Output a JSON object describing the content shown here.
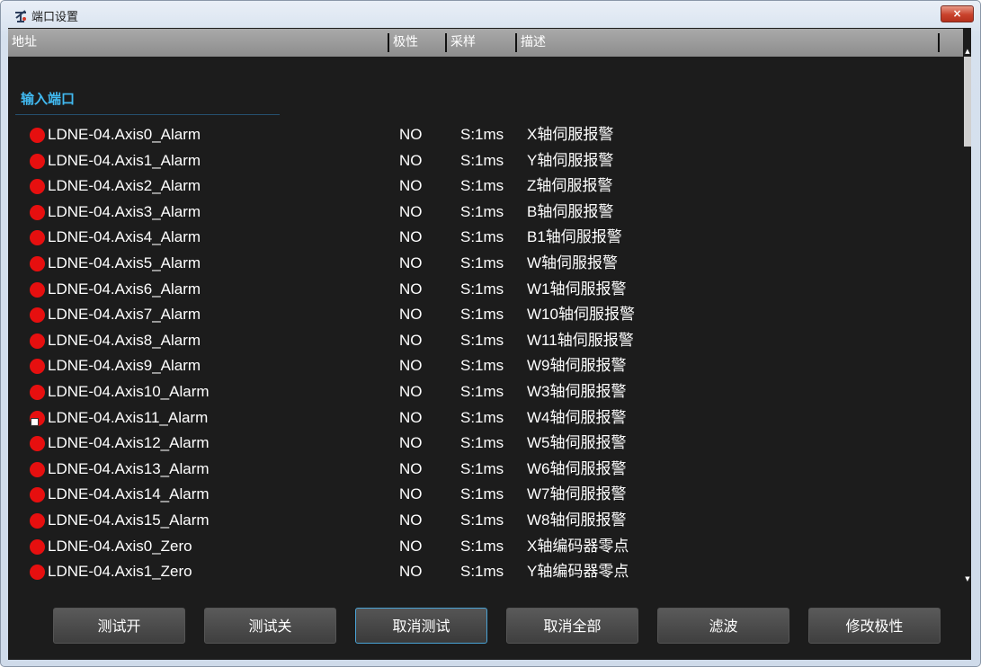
{
  "window": {
    "title": "端口设置",
    "close_label": "×"
  },
  "columns": {
    "address": "地址",
    "polarity": "极性",
    "sampling": "采样",
    "description": "描述"
  },
  "section": {
    "label": "输入端口"
  },
  "rows": [
    {
      "address": "LDNE-04.Axis0_Alarm",
      "polarity": "NO",
      "sampling": "S:1ms",
      "description": "X轴伺服报警",
      "status": "red"
    },
    {
      "address": "LDNE-04.Axis1_Alarm",
      "polarity": "NO",
      "sampling": "S:1ms",
      "description": "Y轴伺服报警",
      "status": "red"
    },
    {
      "address": "LDNE-04.Axis2_Alarm",
      "polarity": "NO",
      "sampling": "S:1ms",
      "description": "Z轴伺服报警",
      "status": "red"
    },
    {
      "address": "LDNE-04.Axis3_Alarm",
      "polarity": "NO",
      "sampling": "S:1ms",
      "description": "B轴伺服报警",
      "status": "red"
    },
    {
      "address": "LDNE-04.Axis4_Alarm",
      "polarity": "NO",
      "sampling": "S:1ms",
      "description": "B1轴伺服报警",
      "status": "red"
    },
    {
      "address": "LDNE-04.Axis5_Alarm",
      "polarity": "NO",
      "sampling": "S:1ms",
      "description": "W轴伺服报警",
      "status": "red"
    },
    {
      "address": "LDNE-04.Axis6_Alarm",
      "polarity": "NO",
      "sampling": "S:1ms",
      "description": "W1轴伺服报警",
      "status": "red"
    },
    {
      "address": "LDNE-04.Axis7_Alarm",
      "polarity": "NO",
      "sampling": "S:1ms",
      "description": "W10轴伺服报警",
      "status": "red"
    },
    {
      "address": "LDNE-04.Axis8_Alarm",
      "polarity": "NO",
      "sampling": "S:1ms",
      "description": "W11轴伺服报警",
      "status": "red"
    },
    {
      "address": "LDNE-04.Axis9_Alarm",
      "polarity": "NO",
      "sampling": "S:1ms",
      "description": "W9轴伺服报警",
      "status": "red"
    },
    {
      "address": "LDNE-04.Axis10_Alarm",
      "polarity": "NO",
      "sampling": "S:1ms",
      "description": "W3轴伺服报警",
      "status": "red"
    },
    {
      "address": "LDNE-04.Axis11_Alarm",
      "polarity": "NO",
      "sampling": "S:1ms",
      "description": "W4轴伺服报警",
      "status": "red-test"
    },
    {
      "address": "LDNE-04.Axis12_Alarm",
      "polarity": "NO",
      "sampling": "S:1ms",
      "description": "W5轴伺服报警",
      "status": "red"
    },
    {
      "address": "LDNE-04.Axis13_Alarm",
      "polarity": "NO",
      "sampling": "S:1ms",
      "description": "W6轴伺服报警",
      "status": "red"
    },
    {
      "address": "LDNE-04.Axis14_Alarm",
      "polarity": "NO",
      "sampling": "S:1ms",
      "description": "W7轴伺服报警",
      "status": "red"
    },
    {
      "address": "LDNE-04.Axis15_Alarm",
      "polarity": "NO",
      "sampling": "S:1ms",
      "description": "W8轴伺服报警",
      "status": "red"
    },
    {
      "address": "LDNE-04.Axis0_Zero",
      "polarity": "NO",
      "sampling": "S:1ms",
      "description": "X轴编码器零点",
      "status": "red"
    },
    {
      "address": "LDNE-04.Axis1_Zero",
      "polarity": "NO",
      "sampling": "S:1ms",
      "description": "Y轴编码器零点",
      "status": "red"
    },
    {
      "address": "",
      "polarity": "",
      "sampling": "",
      "description": "",
      "status": "green"
    }
  ],
  "buttons": [
    {
      "label": "测试开",
      "name": "test-on-button"
    },
    {
      "label": "测试关",
      "name": "test-off-button"
    },
    {
      "label": "取消测试",
      "name": "cancel-test-button",
      "focused": true
    },
    {
      "label": "取消全部",
      "name": "cancel-all-button"
    },
    {
      "label": "滤波",
      "name": "filter-button"
    },
    {
      "label": "修改极性",
      "name": "change-polarity-button"
    }
  ],
  "colors": {
    "status_on": "#e60f0f",
    "status_off": "#1ecb35",
    "section_label": "#41b9f0",
    "background": "#1c1c1c",
    "header": "#9a9a9a"
  },
  "icons": {
    "app": "axis-icon",
    "close": "close-icon",
    "scroll_up": "up-arrow-icon",
    "scroll_down": "down-arrow-icon"
  }
}
